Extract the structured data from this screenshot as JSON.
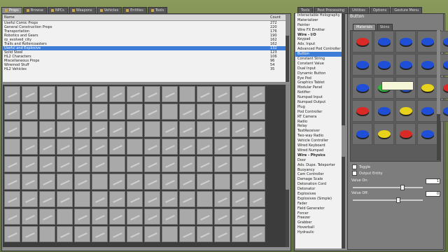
{
  "spawn_tabs": [
    {
      "label": "Props",
      "active": true
    },
    {
      "label": "Browse",
      "active": false
    },
    {
      "label": "NPCs",
      "active": false
    },
    {
      "label": "Weapons",
      "active": false
    },
    {
      "label": "Vehicles",
      "active": false
    },
    {
      "label": "Entities",
      "active": false
    },
    {
      "label": "Tools",
      "active": false
    }
  ],
  "right_tabs": [
    {
      "label": "Tools",
      "active": false
    },
    {
      "label": "Post Processing",
      "active": false
    },
    {
      "label": "Utilities",
      "active": false
    },
    {
      "label": "Options",
      "active": false
    },
    {
      "label": "Gesture Menu",
      "active": false
    }
  ],
  "prop_list": {
    "header_name": "Name",
    "header_count": "Count",
    "rows": [
      {
        "name": "Useful Comic Props",
        "count": "272"
      },
      {
        "name": "General Construction Props",
        "count": "220"
      },
      {
        "name": "Transportation",
        "count": "176"
      },
      {
        "name": "Robotics and Gears",
        "count": "190"
      },
      {
        "name": "rp_evolved_city",
        "count": "162"
      },
      {
        "name": "Trails and Rollercoasters",
        "count": "162"
      },
      {
        "name": "Useful and Explosive",
        "count": "132",
        "selected": true
      },
      {
        "name": "Solid Steel",
        "count": "123"
      },
      {
        "name": "HL2 Characters",
        "count": "106"
      },
      {
        "name": "Miscellaneous Props",
        "count": "96"
      },
      {
        "name": "Wiremod Stuff",
        "count": "54"
      },
      {
        "name": "HL2 Vehicles",
        "count": "35"
      }
    ]
  },
  "wire_list": [
    {
      "label": "Interactable Holography"
    },
    {
      "label": "Materializer"
    },
    {
      "label": "Painter"
    },
    {
      "label": "Wire FX Emitter"
    },
    {
      "label": "Wire - I/O",
      "header": true
    },
    {
      "label": "Keypad"
    },
    {
      "label": "Adv. Input"
    },
    {
      "label": "Advanced Pod Controller"
    },
    {
      "label": "Button",
      "selected": true
    },
    {
      "label": "Constant String"
    },
    {
      "label": "Constant Value"
    },
    {
      "label": "Dual Input"
    },
    {
      "label": "Dynamic Button"
    },
    {
      "label": "Eye Pod"
    },
    {
      "label": "Graphics Tablet"
    },
    {
      "label": "Modular Panel"
    },
    {
      "label": "Notifier"
    },
    {
      "label": "Numpad Input"
    },
    {
      "label": "Numpad Output"
    },
    {
      "label": "Plug"
    },
    {
      "label": "Pod Controller"
    },
    {
      "label": "RT Camera"
    },
    {
      "label": "Radio"
    },
    {
      "label": "Relay"
    },
    {
      "label": "TextReceiver"
    },
    {
      "label": "Two-way Radio"
    },
    {
      "label": "Vehicle Controller"
    },
    {
      "label": "Wired Keyboard"
    },
    {
      "label": "Wired Numpad"
    },
    {
      "label": "Wire - Physics",
      "header": true
    },
    {
      "label": "Door"
    },
    {
      "label": "Adv. Dupe. Teleporter"
    },
    {
      "label": "Buoyancy"
    },
    {
      "label": "Cam Controller"
    },
    {
      "label": "Damage Scale"
    },
    {
      "label": "Detonation Cord"
    },
    {
      "label": "Detonator"
    },
    {
      "label": "Explosives"
    },
    {
      "label": "Explosives (Simple)"
    },
    {
      "label": "Fader"
    },
    {
      "label": "Field Generator"
    },
    {
      "label": "Forcer"
    },
    {
      "label": "Freezer"
    },
    {
      "label": "Grabber"
    },
    {
      "label": "Hoverball"
    },
    {
      "label": "Hydraulic"
    }
  ],
  "tool_panel": {
    "title": "Button",
    "inner_tabs": [
      "Materials",
      "Skins"
    ],
    "toggle_label": "Toggle",
    "output_entity_label": "Output Entity",
    "value_on_label": "Value On:",
    "value_on": "1",
    "value_off_label": "Value Off:",
    "value_off": "0"
  },
  "button_colors": [
    "red",
    "blue",
    "blue",
    "blue",
    "blue",
    "blue",
    "blue",
    "blue",
    "blue",
    "blue",
    "blue",
    "green",
    "blue",
    "yellow",
    "red",
    "red",
    "blue",
    "yellow",
    "blue",
    "blue",
    "blue",
    "yellow",
    "red",
    "blue"
  ],
  "colors": {
    "red": "#d92a25",
    "blue": "#1f4fd6",
    "yellow": "#e8d21b",
    "green": "#2eb53a",
    "selection": "#3d7dd8"
  }
}
